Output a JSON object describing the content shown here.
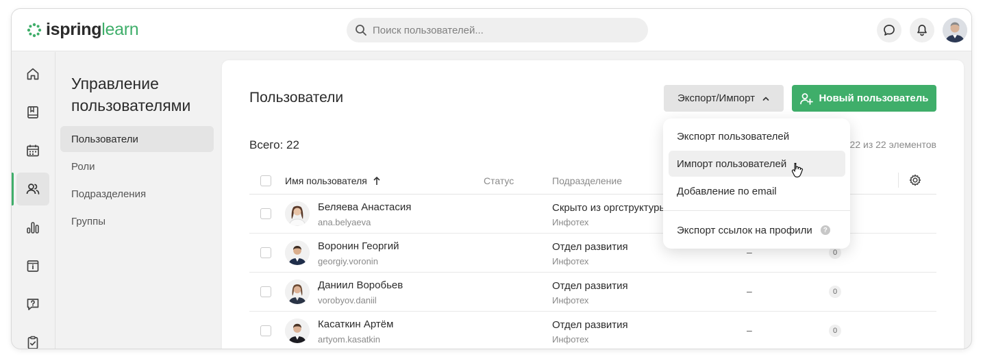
{
  "app": {
    "logo_part1": "ispring",
    "logo_part2": "learn",
    "brand_color": "#3fae6a"
  },
  "search": {
    "placeholder": "Поиск пользователей..."
  },
  "section": {
    "title_line1": "Управление",
    "title_line2": "пользователями",
    "items": [
      {
        "label": "Пользователи",
        "active": true
      },
      {
        "label": "Роли"
      },
      {
        "label": "Подразделения"
      },
      {
        "label": "Группы"
      }
    ]
  },
  "page": {
    "title": "Пользователи",
    "total": "Всего: 22",
    "pager": "22 из 22 элементов",
    "export_import_label": "Экспорт/Импорт",
    "new_user_label": "Новый пользователь"
  },
  "table": {
    "headers": {
      "name": "Имя пользователя",
      "status": "Статус",
      "department": "Подразделение"
    },
    "rows": [
      {
        "name": "Беляева Анастасия",
        "login": "ana.belyaeva",
        "department": "Скрыто из оргструктуры",
        "org": "Инфотех",
        "col4": "",
        "count": ""
      },
      {
        "name": "Воронин Георгий",
        "login": "georgiy.voronin",
        "department": "Отдел развития",
        "org": "Инфотех",
        "col4": "–",
        "count": "0"
      },
      {
        "name": "Даниил Воробьев",
        "login": "vorobyov.daniil",
        "department": "Отдел развития",
        "org": "Инфотех",
        "col4": "–",
        "count": "0"
      },
      {
        "name": "Касаткин Артём",
        "login": "artyom.kasatkin",
        "department": "Отдел развития",
        "org": "Инфотех",
        "col4": "–",
        "count": "0"
      }
    ]
  },
  "dropdown": {
    "items": [
      {
        "label": "Экспорт пользователей"
      },
      {
        "label": "Импорт пользователей",
        "hovered": true
      },
      {
        "label": "Добавление по email"
      },
      {
        "label": "Экспорт ссылок на профили",
        "help": "?"
      }
    ]
  },
  "icons": {
    "rail": [
      "home-icon",
      "book-icon",
      "calendar-icon",
      "users-icon",
      "chart-icon",
      "info-card-icon",
      "question-icon",
      "clipboard-check-icon"
    ],
    "top": [
      "chat-icon",
      "bell-icon"
    ]
  }
}
